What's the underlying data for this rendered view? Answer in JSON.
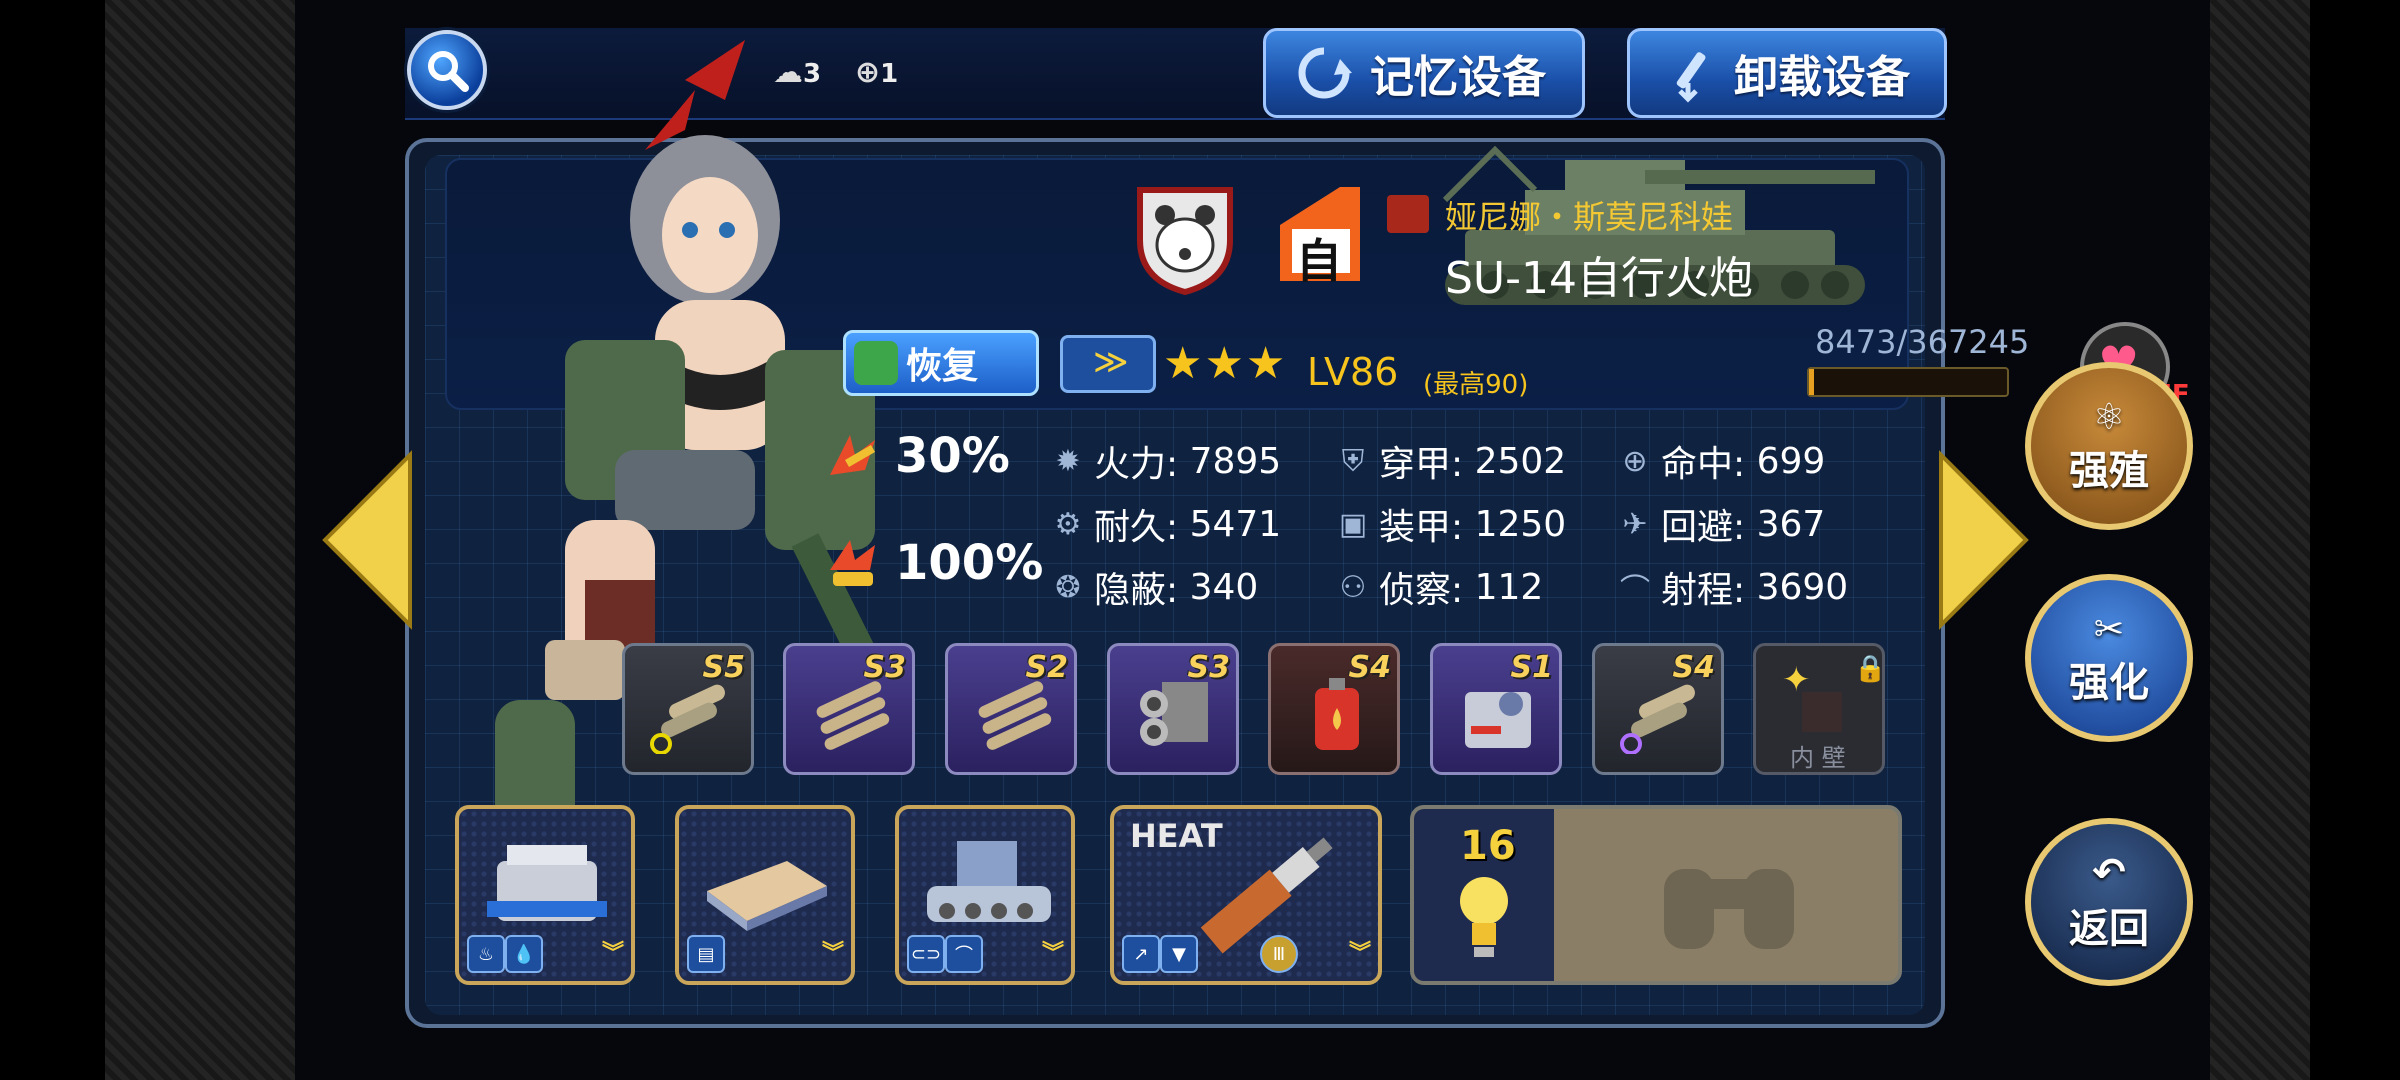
{
  "top_bar": {
    "resource_1_count": "3",
    "resource_2_count": "1",
    "memory_button": "记忆设备",
    "unload_button": "卸载设备"
  },
  "unit": {
    "pilot_name": "娅尼娜・斯莫尼科娃",
    "vehicle_name": "SU-14自行火炮",
    "auto_badge": "自",
    "exp_text": "8473/367245",
    "exp_progress": 0.023,
    "level": "LV86",
    "max_level": "(最高90)",
    "stars": "★★★",
    "restore_button": "恢复",
    "favorite_toggle": "OFF"
  },
  "percentages": {
    "anti_air": "30%",
    "anti_ground": "100%"
  },
  "stats": [
    {
      "label": "火力:",
      "value": "7895",
      "icon": "firepower-icon"
    },
    {
      "label": "穿甲:",
      "value": "2502",
      "icon": "penetration-icon"
    },
    {
      "label": "命中:",
      "value": "699",
      "icon": "accuracy-icon"
    },
    {
      "label": "耐久:",
      "value": "5471",
      "icon": "durability-icon"
    },
    {
      "label": "装甲:",
      "value": "1250",
      "icon": "armor-icon"
    },
    {
      "label": "回避:",
      "value": "367",
      "icon": "evasion-icon"
    },
    {
      "label": "隐蔽:",
      "value": "340",
      "icon": "stealth-icon"
    },
    {
      "label": "侦察:",
      "value": "112",
      "icon": "recon-icon"
    },
    {
      "label": "射程:",
      "value": "3690",
      "icon": "range-icon"
    }
  ],
  "equipment": [
    {
      "tier": "S5",
      "icon": "pipe-icon"
    },
    {
      "tier": "S3",
      "icon": "shells-icon"
    },
    {
      "tier": "S2",
      "icon": "shells-icon"
    },
    {
      "tier": "S3",
      "icon": "engine-block-icon"
    },
    {
      "tier": "S4",
      "icon": "fuel-can-icon"
    },
    {
      "tier": "S1",
      "icon": "radio-icon"
    },
    {
      "tier": "S4",
      "icon": "pipe-icon"
    }
  ],
  "locked_slot": {
    "label": "内 壁"
  },
  "parts": {
    "heat_label": "HEAT",
    "bulb_count": "16"
  },
  "right_buttons": {
    "breed": "强殖",
    "enhance": "强化",
    "back": "返回"
  },
  "colors": {
    "gold": "#f6d13e",
    "panel_blue": "#0f2240",
    "button_blue": "#2a6ad0",
    "brown_button": "#8a5a1c"
  }
}
